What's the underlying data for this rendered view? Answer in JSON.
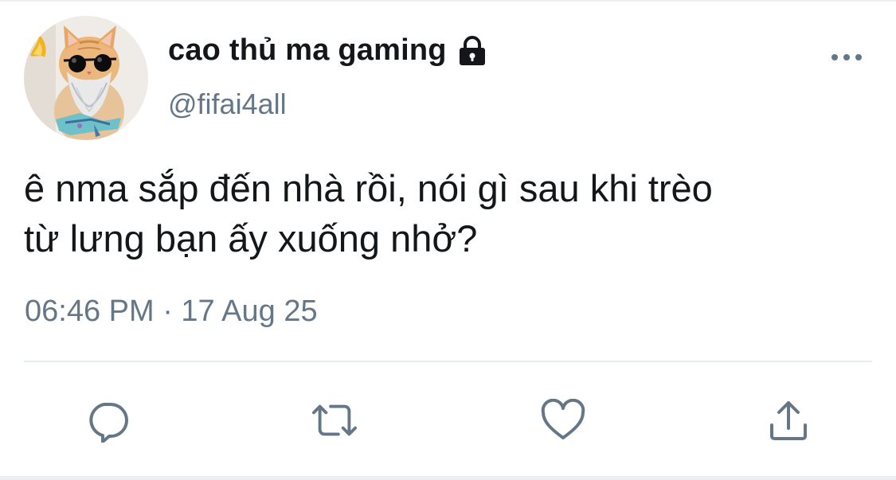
{
  "user": {
    "display_name": "cao thủ ma gaming",
    "handle": "@fifai4all",
    "protected_icon": "lock-icon",
    "avatar_icon": "cat-with-sunglasses-avatar"
  },
  "tweet": {
    "text": "ê nma sắp đến nhà rồi, nói gì sau khi trèo\ntừ lưng bạn ấy xuống nhở?",
    "timestamp": "06:46 PM · 17 Aug 25"
  },
  "actions": {
    "more_icon": "more-options-icon",
    "reply_icon": "reply-icon",
    "retweet_icon": "retweet-icon",
    "like_icon": "heart-icon",
    "share_icon": "share-icon"
  },
  "colors": {
    "text_primary": "#14171a",
    "text_secondary": "#657786",
    "icon": "#657786",
    "divider": "#e6ecf0"
  }
}
